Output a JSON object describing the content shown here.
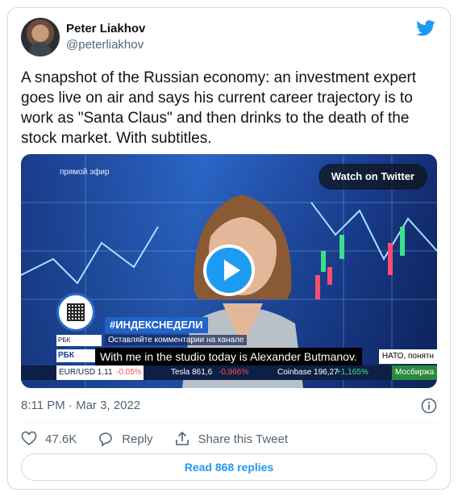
{
  "author": {
    "name": "Peter Liakhov",
    "handle": "@peterliakhov"
  },
  "tweet": {
    "text": "A snapshot of the Russian economy: an investment expert\ngoes live on air and says his current career trajectory is to\nwork as \"Santa Claus\" and then drinks to the death of the\nstock market. With subtitles."
  },
  "media": {
    "live_label": "прямой эфир",
    "watch_label": "Watch on Twitter",
    "hashtag": "#ИНДЕКСНЕДЕЛИ",
    "comment_text": "Оставляйте комментарии на канале",
    "rbk_top": "РБК Инвестиции",
    "rbk_logo": "РБК",
    "subtitle": "With me in the studio today is Alexander Butmanov.",
    "nato_text": "НАТО, понятн",
    "ticker": {
      "eur": "EUR/USD 1.11",
      "eur_change": "-0.05%",
      "tesla": "Tesla 861,6",
      "tesla_change": "-0,966%",
      "coinbase": "Coinbase 196,27",
      "coinbase_change": "+1,165%",
      "moscow": "Мосбиржа"
    }
  },
  "meta": {
    "timestamp": "8:11 PM · Mar 3, 2022"
  },
  "actions": {
    "likes": "47.6K",
    "reply": "Reply",
    "share": "Share this Tweet"
  },
  "replies_button": "Read 868 replies",
  "colors": {
    "accent": "#1d9bf0",
    "secondary_text": "#536471"
  },
  "icons": [
    "twitter-bird-icon",
    "play-icon",
    "info-icon",
    "heart-icon",
    "reply-icon",
    "share-icon"
  ]
}
